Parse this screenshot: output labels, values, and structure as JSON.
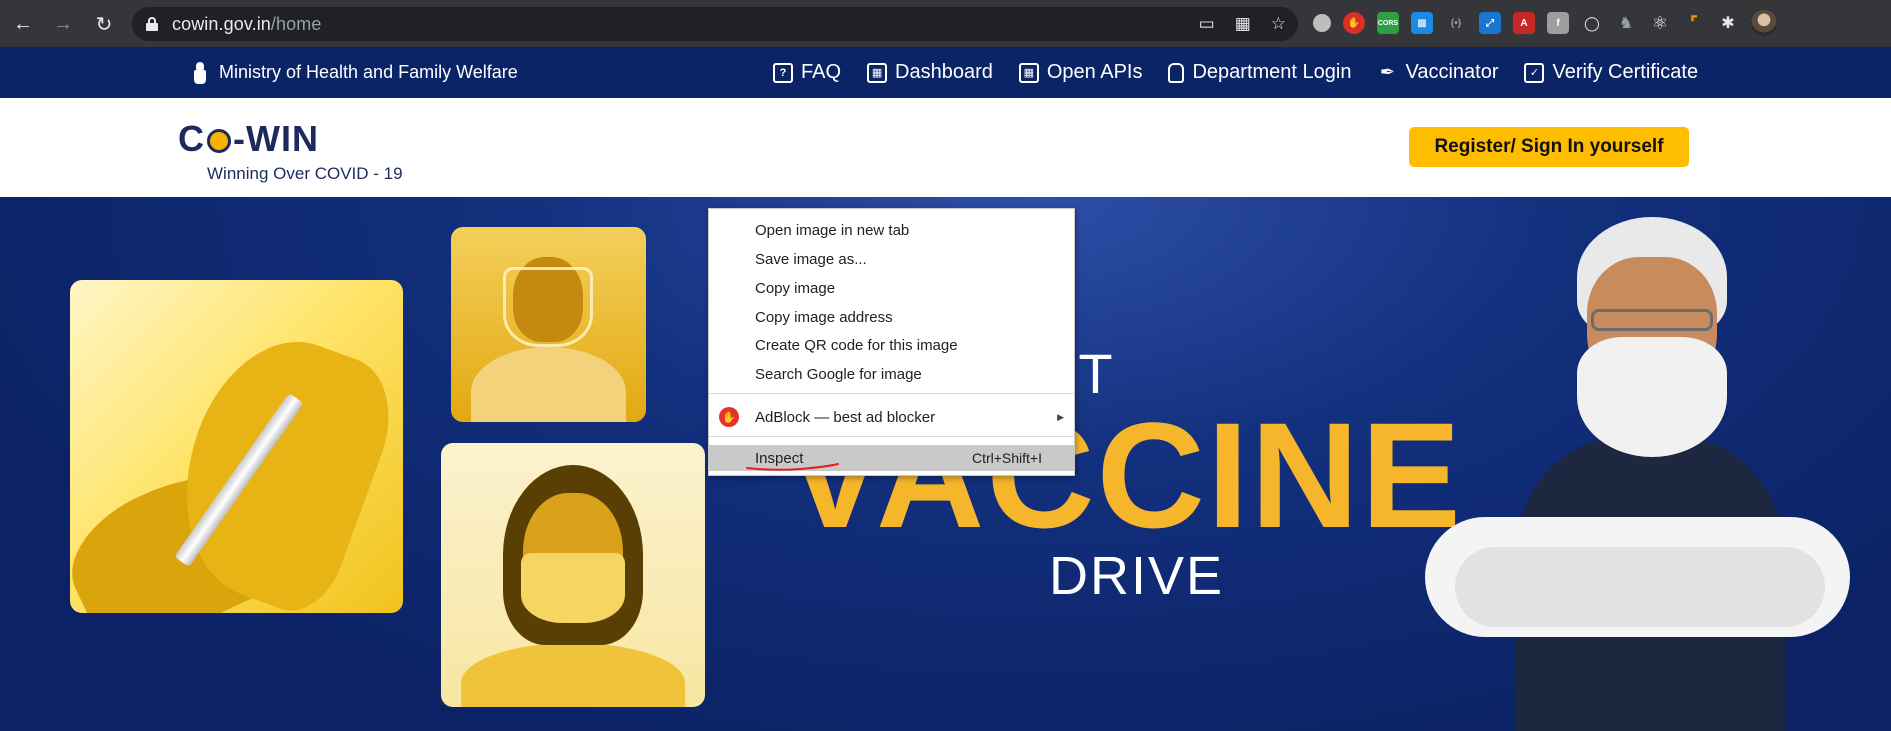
{
  "browser": {
    "url_host": "cowin.gov.in",
    "url_path": "/home",
    "extensions": [
      "chrome-ext-icon",
      "adblock-icon",
      "cors-icon",
      "trello-icon",
      "dots-icon",
      "expand-icon",
      "pdf-icon",
      "facebook-icon",
      "reader-icon",
      "puzzle-icon",
      "react-icon",
      "ruler-icon",
      "extensions-icon"
    ],
    "cors_label": "CORS"
  },
  "topbar": {
    "ministry": "Ministry of Health and Family Welfare",
    "nav": [
      {
        "label": "FAQ",
        "icon": "faq-icon"
      },
      {
        "label": "Dashboard",
        "icon": "dashboard-icon"
      },
      {
        "label": "Open APIs",
        "icon": "api-icon"
      },
      {
        "label": "Department Login",
        "icon": "lock-icon"
      },
      {
        "label": "Vaccinator",
        "icon": "syringe-icon"
      },
      {
        "label": "Verify Certificate",
        "icon": "certificate-icon"
      }
    ]
  },
  "header": {
    "logo_left": "C",
    "logo_right": "-WIN",
    "tagline": "Winning Over COVID - 19",
    "register_button": "Register/ Sign In yourself"
  },
  "hero": {
    "line1_partial": "ST",
    "line2": "VACCINE",
    "line3": "DRIVE"
  },
  "context_menu": {
    "items": [
      "Open image in new tab",
      "Save image as...",
      "Copy image",
      "Copy image address",
      "Create QR code for this image",
      "Search Google for image"
    ],
    "adblock": "AdBlock — best ad blocker",
    "inspect": "Inspect",
    "inspect_shortcut": "Ctrl+Shift+I"
  },
  "colors": {
    "navy": "#0a2466",
    "accent": "#ffbd00",
    "vaccine_text": "#f6b62b",
    "annotation": "#e0201b"
  }
}
